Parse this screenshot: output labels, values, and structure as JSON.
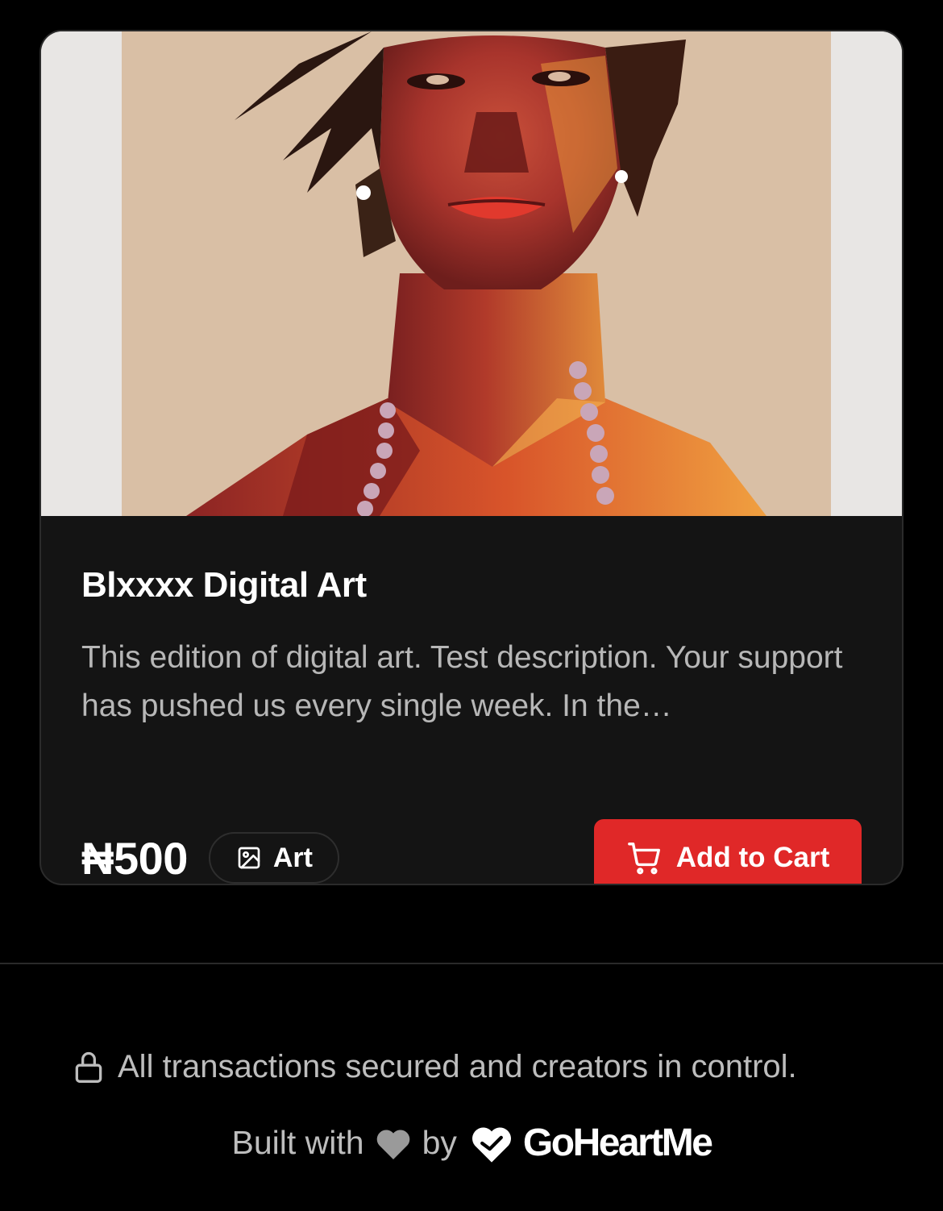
{
  "product": {
    "image_alt": "Stylized digital portrait artwork",
    "title": "Blxxxx Digital Art",
    "description": "This edition of digital art. Test description. Your support has pushed us every single week. In the…",
    "price": "₦500",
    "category": {
      "label": "Art",
      "icon": "image-icon"
    },
    "add_to_cart": {
      "label": "Add to Cart",
      "icon": "cart-icon"
    }
  },
  "footer": {
    "secure_text": "All transactions secured and creators in control.",
    "secure_icon": "lock-icon",
    "built_with_text": "Built with",
    "by_text": "by",
    "brand_name": "GoHeartMe",
    "heart_icon": "heart-icon"
  },
  "colors": {
    "background": "#000000",
    "card": "#141414",
    "accent": "#e02828",
    "muted_text": "#b7b7b7"
  }
}
